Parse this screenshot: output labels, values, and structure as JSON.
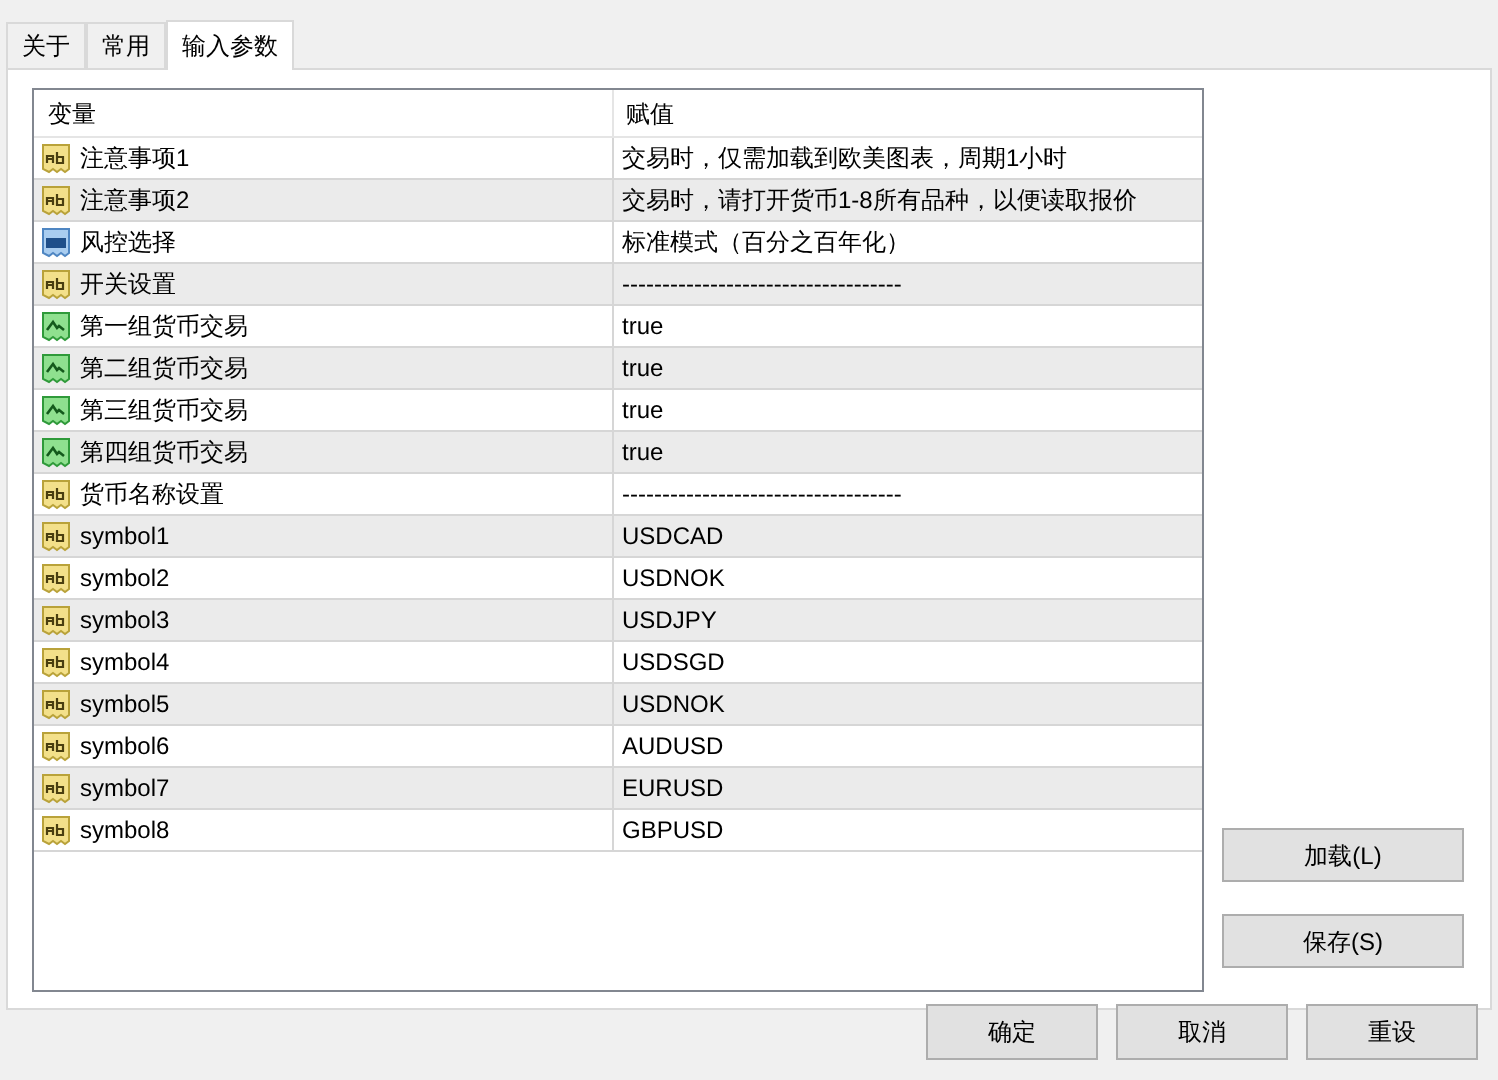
{
  "tabs": [
    {
      "label": "关于",
      "selected": false
    },
    {
      "label": "常用",
      "selected": false
    },
    {
      "label": "输入参数",
      "selected": true
    }
  ],
  "table": {
    "columns": [
      "变量",
      "赋值"
    ],
    "rows": [
      {
        "kind": "text",
        "name": "注意事项1",
        "value": "交易时，仅需加载到欧美图表，周期1小时"
      },
      {
        "kind": "text",
        "name": "注意事项2",
        "value": "交易时，请打开货币1-8所有品种，以便读取报价"
      },
      {
        "kind": "number",
        "name": "风控选择",
        "value": "标准模式（百分之百年化）"
      },
      {
        "kind": "text",
        "name": "开关设置",
        "value": "-----------------------------------"
      },
      {
        "kind": "bool",
        "name": "第一组货币交易",
        "value": "true"
      },
      {
        "kind": "bool",
        "name": "第二组货币交易",
        "value": "true"
      },
      {
        "kind": "bool",
        "name": "第三组货币交易",
        "value": "true"
      },
      {
        "kind": "bool",
        "name": "第四组货币交易",
        "value": "true"
      },
      {
        "kind": "text",
        "name": "货币名称设置",
        "value": "-----------------------------------"
      },
      {
        "kind": "text",
        "name": "symbol1",
        "value": "USDCAD"
      },
      {
        "kind": "text",
        "name": "symbol2",
        "value": "USDNOK"
      },
      {
        "kind": "text",
        "name": "symbol3",
        "value": "USDJPY"
      },
      {
        "kind": "text",
        "name": "symbol4",
        "value": "USDSGD"
      },
      {
        "kind": "text",
        "name": "symbol5",
        "value": "USDNOK"
      },
      {
        "kind": "text",
        "name": "symbol6",
        "value": "AUDUSD"
      },
      {
        "kind": "text",
        "name": "symbol7",
        "value": "EURUSD"
      },
      {
        "kind": "text",
        "name": "symbol8",
        "value": "GBPUSD"
      }
    ]
  },
  "side_buttons": [
    "加载(L)",
    "保存(S)"
  ],
  "buttons": [
    "确定",
    "取消",
    "重设"
  ]
}
